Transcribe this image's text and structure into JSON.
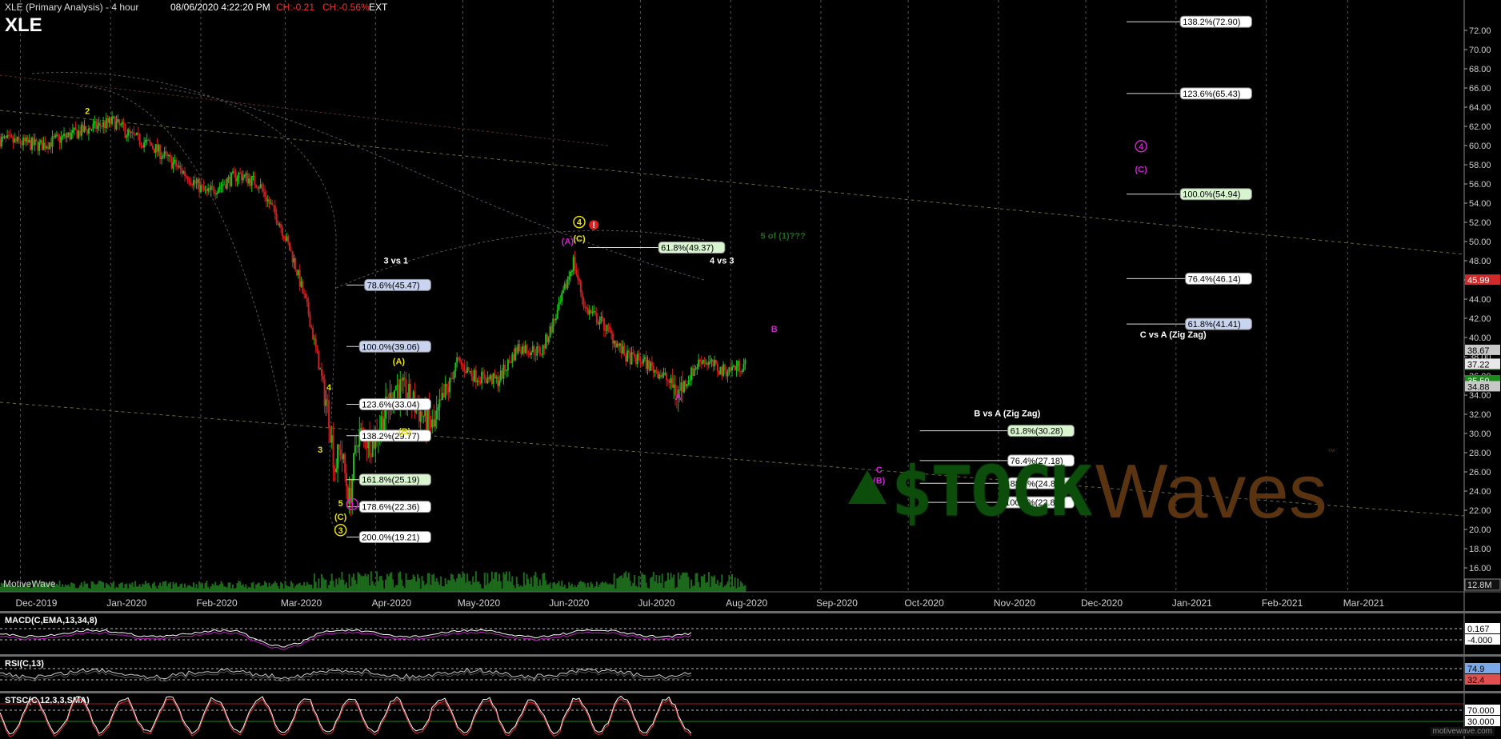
{
  "header": {
    "title": "XLE (Primary Analysis) - 4 hour",
    "datetime": "08/06/2020 4:22:20 PM",
    "change": "CH:-0.21",
    "change_pct": "CH:-0.56%",
    "session": "EXT",
    "symbol": "XLE"
  },
  "branding": {
    "watermark": "MotiveWave",
    "logo_stock": "$TOCK",
    "logo_waves": "Waves",
    "logo_tm": "™",
    "site": "motivewave.com"
  },
  "colors": {
    "background": "#000000",
    "candle_up": "#1bbf1b",
    "candle_down": "#d01d1d",
    "wave_yellow": "#e8e000",
    "wave_magenta": "#d020d0",
    "fib_box_white": "#ffffff",
    "fib_box_blue": "#c8d4f0",
    "fib_box_green": "#d8f5d0",
    "price_tag_red": "#d02a2a"
  },
  "chart_data": {
    "type": "candlestick",
    "x_axis": {
      "labels": [
        "Dec-2019",
        "Jan-2020",
        "Feb-2020",
        "Mar-2020",
        "Apr-2020",
        "May-2020",
        "Jun-2020",
        "Jul-2020",
        "Aug-2020",
        "Sep-2020",
        "Oct-2020",
        "Nov-2020",
        "Dec-2020",
        "Jan-2021",
        "Feb-2021",
        "Mar-2021"
      ],
      "range": [
        "2019-11-24",
        "2021-04-10"
      ]
    },
    "y_axis": {
      "range": [
        13.5,
        74
      ],
      "ticks": [
        16,
        18,
        20,
        22,
        24,
        26,
        28,
        30,
        32,
        34,
        36,
        38,
        40,
        42,
        44,
        46,
        48,
        50,
        52,
        54,
        56,
        58,
        60,
        62,
        64,
        66,
        68,
        70,
        72
      ],
      "tick_labels": [
        "16.00",
        "18.00",
        "20.00",
        "22.00",
        "24.00",
        "26.00",
        "28.00",
        "30.00",
        "32.00",
        "34.00",
        "36.00",
        "38.00",
        "40.00",
        "42.00",
        "44.00",
        "46.00",
        "48.00",
        "50.00",
        "52.00",
        "54.00",
        "56.00",
        "58.00",
        "60.00",
        "62.00",
        "64.00",
        "66.00",
        "68.00",
        "70.00",
        "72.00"
      ],
      "volume_label": "12.8M"
    },
    "price_path": [
      [
        "2019-11-24",
        60.6
      ],
      [
        "2019-12-08",
        60.0
      ],
      [
        "2019-12-22",
        61.5
      ],
      [
        "2020-01-02",
        62.5
      ],
      [
        "2020-01-08",
        61.0
      ],
      [
        "2020-01-15",
        60.0
      ],
      [
        "2020-01-25",
        57.5
      ],
      [
        "2020-02-03",
        55.0
      ],
      [
        "2020-02-14",
        57.0
      ],
      [
        "2020-02-21",
        56.0
      ],
      [
        "2020-02-28",
        52.0
      ],
      [
        "2020-03-04",
        48.0
      ],
      [
        "2020-03-09",
        42.5
      ],
      [
        "2020-03-12",
        38.0
      ],
      [
        "2020-03-16",
        32.0
      ],
      [
        "2020-03-18",
        26.5
      ],
      [
        "2020-03-20",
        28.5
      ],
      [
        "2020-03-23",
        23.0
      ],
      [
        "2020-03-26",
        30.0
      ],
      [
        "2020-03-31",
        29.0
      ],
      [
        "2020-04-08",
        35.0
      ],
      [
        "2020-04-13",
        33.5
      ],
      [
        "2020-04-21",
        30.5
      ],
      [
        "2020-04-29",
        37.5
      ],
      [
        "2020-05-05",
        36.0
      ],
      [
        "2020-05-13",
        35.5
      ],
      [
        "2020-05-20",
        39.0
      ],
      [
        "2020-05-28",
        38.5
      ],
      [
        "2020-06-03",
        43.0
      ],
      [
        "2020-06-08",
        48.0
      ],
      [
        "2020-06-12",
        43.0
      ],
      [
        "2020-06-18",
        41.5
      ],
      [
        "2020-06-26",
        38.0
      ],
      [
        "2020-07-02",
        37.5
      ],
      [
        "2020-07-09",
        36.0
      ],
      [
        "2020-07-14",
        34.3
      ],
      [
        "2020-07-22",
        37.8
      ],
      [
        "2020-07-29",
        36.5
      ],
      [
        "2020-08-06",
        37.2
      ]
    ],
    "current_price": {
      "label": "37.22",
      "value": 37.22
    },
    "price_tags": [
      {
        "label": "45.99",
        "value": 45.99,
        "color": "#d02a2a"
      },
      {
        "label": "38.67",
        "value": 38.67,
        "color": "#c8c8c8"
      },
      {
        "label": "37.13",
        "value": 37.13,
        "color": "#1a8a1a"
      },
      {
        "label": "35.50",
        "value": 35.5,
        "color": "#1a8a1a"
      },
      {
        "label": "34.88",
        "value": 34.88,
        "color": "#c8c8c8"
      }
    ],
    "fib_levels": [
      {
        "label": "78.6%(45.47)",
        "value": 45.47,
        "x_start": "2020-03-22",
        "x_end": "2020-04-20",
        "box": "blue"
      },
      {
        "label": "100.0%(39.06)",
        "value": 39.06,
        "x_start": "2020-03-22",
        "x_end": "2020-04-20",
        "box": "blue"
      },
      {
        "label": "123.6%(33.04)",
        "value": 33.04,
        "x_start": "2020-03-22",
        "x_end": "2020-04-20",
        "box": "white"
      },
      {
        "label": "138.2%(29.77)",
        "value": 29.77,
        "x_start": "2020-03-22",
        "x_end": "2020-04-20",
        "box": "white"
      },
      {
        "label": "161.8%(25.19)",
        "value": 25.19,
        "x_start": "2020-03-22",
        "x_end": "2020-04-20",
        "box": "green"
      },
      {
        "label": "178.6%(22.36)",
        "value": 22.36,
        "x_start": "2020-03-22",
        "x_end": "2020-04-20",
        "box": "white"
      },
      {
        "label": "200.0%(19.21)",
        "value": 19.21,
        "x_start": "2020-03-22",
        "x_end": "2020-04-20",
        "box": "white"
      },
      {
        "label": "61.8%(49.37)",
        "value": 49.37,
        "x_start": "2020-06-13",
        "x_end": "2020-07-30",
        "box": "green"
      },
      {
        "label": "61.8%(30.28)",
        "value": 30.28,
        "x_start": "2020-10-05",
        "x_end": "2020-11-27",
        "box": "green"
      },
      {
        "label": "76.4%(27.18)",
        "value": 27.18,
        "x_start": "2020-10-05",
        "x_end": "2020-11-27",
        "box": "white"
      },
      {
        "label": "88.7%(24.81)",
        "value": 24.81,
        "x_start": "2020-10-05",
        "x_end": "2020-11-27",
        "box": "white"
      },
      {
        "label": "100.0%(22.82)",
        "value": 22.82,
        "x_start": "2020-10-05",
        "x_end": "2020-11-27",
        "box": "white"
      },
      {
        "label": "138.2%(72.90)",
        "value": 72.9,
        "x_start": "2020-12-15",
        "x_end": "2021-01-27",
        "box": "white"
      },
      {
        "label": "123.6%(65.43)",
        "value": 65.43,
        "x_start": "2020-12-15",
        "x_end": "2021-01-27",
        "box": "white"
      },
      {
        "label": "100.0%(54.94)",
        "value": 54.94,
        "x_start": "2020-12-15",
        "x_end": "2021-01-27",
        "box": "green"
      },
      {
        "label": "76.4%(46.14)",
        "value": 46.14,
        "x_start": "2020-12-15",
        "x_end": "2021-01-27",
        "box": "white"
      },
      {
        "label": "61.8%(41.41)",
        "value": 41.41,
        "x_start": "2020-12-15",
        "x_end": "2021-01-27",
        "box": "blue"
      }
    ],
    "annotations": [
      {
        "text": "3 vs 1",
        "x": "2020-04-08",
        "y": 47.7,
        "color": "#ffffff"
      },
      {
        "text": "4 vs 3",
        "x": "2020-07-29",
        "y": 47.7,
        "color": "#ffffff"
      },
      {
        "text": "5 of (1)???",
        "x": "2020-08-19",
        "y": 50.3,
        "color": "#1f6a1f"
      },
      {
        "text": "B vs A (Zig Zag)",
        "x": "2020-11-04",
        "y": 31.8,
        "color": "#ffffff"
      },
      {
        "text": "C vs A (Zig Zag)",
        "x": "2020-12-31",
        "y": 40.0,
        "color": "#ffffff"
      }
    ],
    "wave_labels": [
      {
        "text": "2",
        "x": "2019-12-24",
        "y": 63.3,
        "color": "#e8e000"
      },
      {
        "text": "3",
        "x": "2020-03-13",
        "y": 28.0,
        "color": "#e8e000"
      },
      {
        "text": "4",
        "x": "2020-03-16",
        "y": 34.5,
        "color": "#e8e000"
      },
      {
        "text": "5",
        "x": "2020-03-20",
        "y": 22.4,
        "color": "#e8e000"
      },
      {
        "text": "(C)",
        "x": "2020-03-20",
        "y": 21.0,
        "color": "#e8e000"
      },
      {
        "text": "3",
        "x": "2020-03-20",
        "y": 19.6,
        "color": "#e8e000",
        "circle": true
      },
      {
        "text": "(A)",
        "x": "2020-04-09",
        "y": 37.2,
        "color": "#e8e000"
      },
      {
        "text": "(B)",
        "x": "2020-04-11",
        "y": 29.9,
        "color": "#e8e000"
      },
      {
        "text": "1",
        "x": "2020-03-24",
        "y": 22.3,
        "color": "#d020d0",
        "circle": true
      },
      {
        "text": "4",
        "x": "2020-06-10",
        "y": 51.7,
        "color": "#e8e000",
        "circle": true
      },
      {
        "text": "(C)",
        "x": "2020-06-10",
        "y": 50.0,
        "color": "#e8e000"
      },
      {
        "text": "(A)",
        "x": "2020-06-06",
        "y": 49.7,
        "color": "#d020d0"
      },
      {
        "text": "!",
        "x": "2020-06-15",
        "y": 51.4,
        "color": "#ffffff",
        "badge": "#e02020"
      },
      {
        "text": "A",
        "x": "2020-07-14",
        "y": 33.5,
        "color": "#d020d0"
      },
      {
        "text": "B",
        "x": "2020-08-16",
        "y": 40.6,
        "color": "#d020d0"
      },
      {
        "text": "C",
        "x": "2020-09-21",
        "y": 25.9,
        "color": "#d020d0"
      },
      {
        "text": "(B)",
        "x": "2020-09-21",
        "y": 24.8,
        "color": "#d020d0"
      },
      {
        "text": "4",
        "x": "2020-12-20",
        "y": 59.6,
        "color": "#d020d0",
        "circle": true
      },
      {
        "text": "(C)",
        "x": "2020-12-20",
        "y": 57.2,
        "color": "#d020d0"
      }
    ],
    "indicators": [
      {
        "name": "MACD(C,EMA,13,34,8)",
        "tick_labels": [
          "0.167",
          "-4.000"
        ]
      },
      {
        "name": "RSI(C,13)",
        "tick_labels": [
          "74.9",
          "32.4"
        ]
      },
      {
        "name": "STSC(C,12,3,3,SMA)",
        "tick_labels": [
          "70.000",
          "30.000"
        ]
      }
    ],
    "grid": true,
    "legend": "none"
  }
}
